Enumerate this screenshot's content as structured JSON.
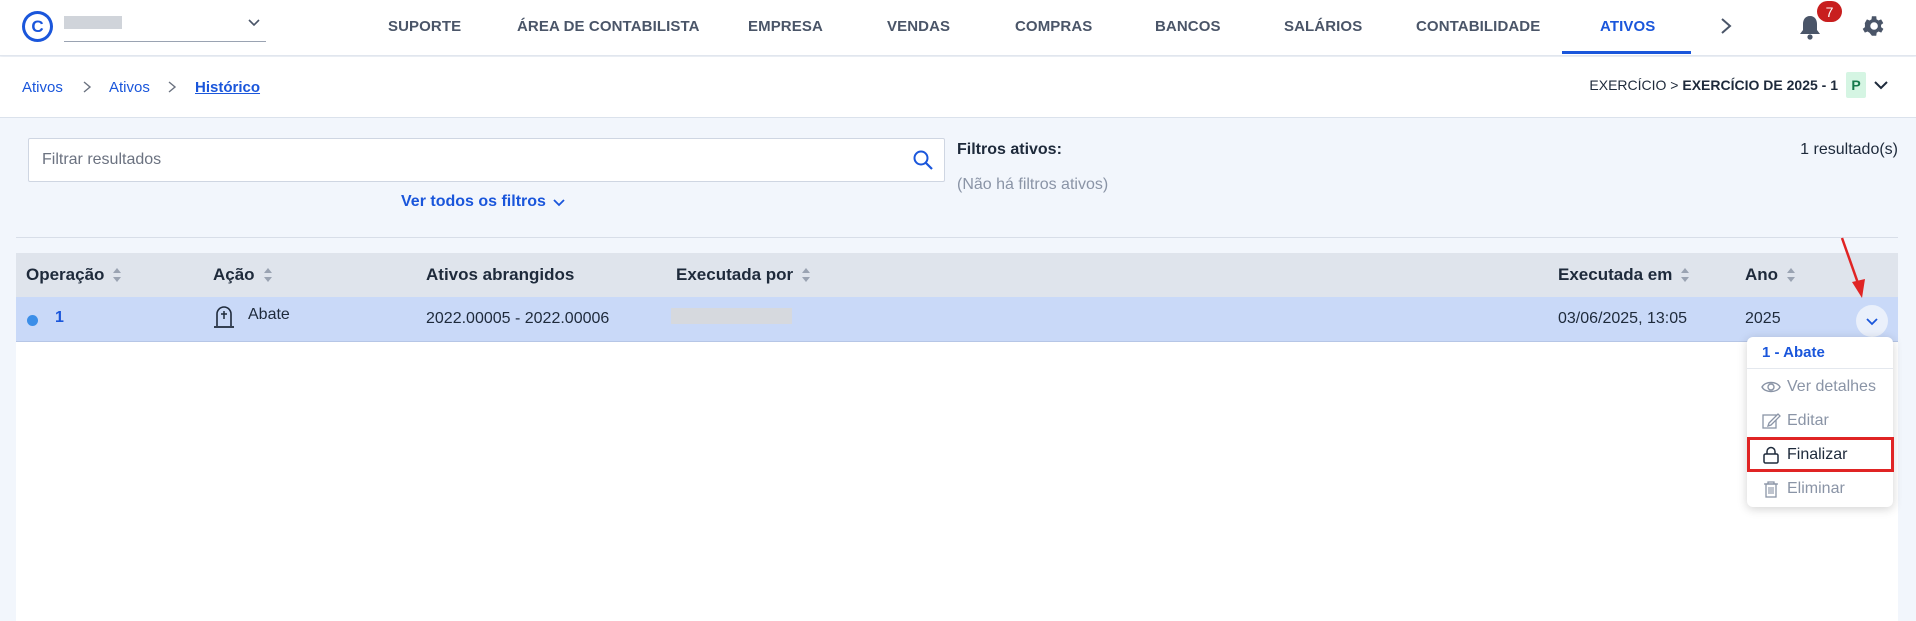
{
  "header": {
    "logo_letter": "C",
    "nav": [
      {
        "label": "SUPORTE",
        "active": false
      },
      {
        "label": "ÁREA DE CONTABILISTA",
        "active": false
      },
      {
        "label": "EMPRESA",
        "active": false
      },
      {
        "label": "VENDAS",
        "active": false
      },
      {
        "label": "COMPRAS",
        "active": false
      },
      {
        "label": "BANCOS",
        "active": false
      },
      {
        "label": "SALÁRIOS",
        "active": false
      },
      {
        "label": "CONTABILIDADE",
        "active": false
      },
      {
        "label": "ATIVOS",
        "active": true
      }
    ],
    "notification_count": "7",
    "icons": {
      "more": "chevron-right-icon",
      "notifications": "bell-icon",
      "settings": "gear-icon"
    }
  },
  "breadcrumb": {
    "items": [
      "Ativos",
      "Ativos",
      "Histórico"
    ],
    "exercise_prefix": "EXERCÍCIO > ",
    "exercise_value": "EXERCÍCIO DE 2025 - 1",
    "exercise_badge": "P"
  },
  "filters": {
    "search_placeholder": "Filtrar resultados",
    "view_all_label": "Ver todos os filtros",
    "active_title": "Filtros ativos:",
    "active_none": "(Não há filtros ativos)",
    "results_count": "1 resultado(s)"
  },
  "table": {
    "headers": [
      "Operação",
      "Ação",
      "Ativos abrangidos",
      "Executada por",
      "Executada em",
      "Ano"
    ],
    "rows": [
      {
        "operation": "1",
        "action": "Abate",
        "assets": "2022.00005 - 2022.00006",
        "executed_by": "",
        "executed_at": "03/06/2025, 13:05",
        "year": "2025"
      }
    ]
  },
  "row_menu": {
    "title": "1 - Abate",
    "items": [
      {
        "label": "Ver detalhes",
        "icon": "eye-icon",
        "enabled": false
      },
      {
        "label": "Editar",
        "icon": "edit-icon",
        "enabled": false
      },
      {
        "label": "Finalizar",
        "icon": "lock-icon",
        "enabled": true,
        "highlighted": true
      },
      {
        "label": "Eliminar",
        "icon": "trash-icon",
        "enabled": false
      }
    ]
  },
  "colors": {
    "accent": "#1a56db",
    "selected_row": "#c9d9f8",
    "highlight": "#e02424",
    "badge": "#c81e1e"
  }
}
